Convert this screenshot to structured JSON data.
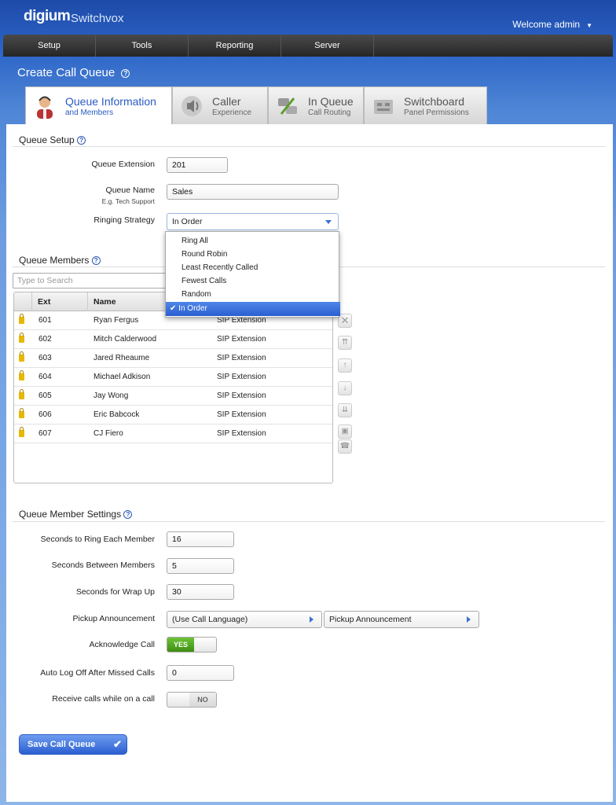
{
  "header": {
    "brand": "digium",
    "product": "Switchvox",
    "welcome": "Welcome admin"
  },
  "nav": [
    "Setup",
    "Tools",
    "Reporting",
    "Server"
  ],
  "page_title": "Create Call Queue",
  "tabs": [
    {
      "title": "Queue Information",
      "subtitle": "and Members",
      "icon": "operator-icon"
    },
    {
      "title": "Caller",
      "subtitle": "Experience",
      "icon": "speaker-icon"
    },
    {
      "title": "In Queue",
      "subtitle": "Call Routing",
      "icon": "routing-icon"
    },
    {
      "title": "Switchboard",
      "subtitle": "Panel Permissions",
      "icon": "switchboard-icon"
    }
  ],
  "queue_setup": {
    "title": "Queue Setup",
    "extension_label": "Queue Extension",
    "extension_value": "201",
    "name_label": "Queue Name",
    "name_hint": "E.g. Tech Support",
    "name_value": "Sales",
    "strategy_label": "Ringing Strategy",
    "strategy_value": "In Order",
    "strategy_options": [
      "Ring All",
      "Round Robin",
      "Least Recently Called",
      "Fewest Calls",
      "Random",
      "In Order"
    ]
  },
  "members": {
    "title": "Queue Members",
    "search_placeholder": "Type to Search",
    "columns": [
      "Ext",
      "Name"
    ],
    "rows": [
      {
        "ext": "601",
        "name": "Ryan Fergus",
        "type": "SIP Extension"
      },
      {
        "ext": "602",
        "name": "Mitch Calderwood",
        "type": "SIP Extension"
      },
      {
        "ext": "603",
        "name": "Jared Rheaume",
        "type": "SIP Extension"
      },
      {
        "ext": "604",
        "name": "Michael Adkison",
        "type": "SIP Extension"
      },
      {
        "ext": "605",
        "name": "Jay Wong",
        "type": "SIP Extension"
      },
      {
        "ext": "606",
        "name": "Eric Babcock",
        "type": "SIP Extension"
      },
      {
        "ext": "607",
        "name": "CJ Fiero",
        "type": "SIP Extension"
      }
    ]
  },
  "member_settings": {
    "title": "Queue Member Settings",
    "ring_label": "Seconds to Ring Each Member",
    "ring_value": "16",
    "between_label": "Seconds Between Members",
    "between_value": "5",
    "wrap_label": "Seconds for Wrap Up",
    "wrap_value": "30",
    "pickup_label": "Pickup Announcement",
    "pickup_lang": "(Use Call Language)",
    "pickup_sound": "Pickup Announcement",
    "ack_label": "Acknowledge Call",
    "ack_value": "YES",
    "autolog_label": "Auto Log Off After Missed Calls",
    "autolog_value": "0",
    "receive_label": "Receive calls while on a call",
    "receive_value": "NO"
  },
  "save_label": "Save Call Queue"
}
